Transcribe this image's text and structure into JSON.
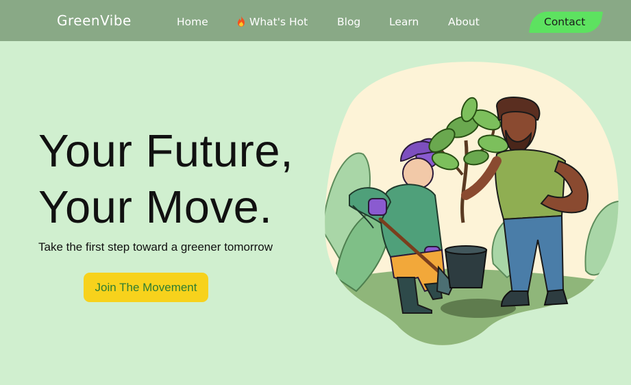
{
  "brand": {
    "name": "GreenVibe"
  },
  "nav": {
    "items": [
      {
        "label": "Home"
      },
      {
        "label": "What's Hot",
        "icon": "fire-icon"
      },
      {
        "label": "Blog"
      },
      {
        "label": "Learn"
      },
      {
        "label": "About"
      }
    ],
    "contact_label": "Contact"
  },
  "hero": {
    "title_line1": "Your Future,",
    "title_line2": "Your Move.",
    "subtitle": "Take the first step toward a greener tomorrow",
    "cta_label": "Join The Movement"
  },
  "colors": {
    "page_bg": "#d0efcf",
    "nav_bg": "#89a986",
    "contact_bg": "#5de260",
    "cta_bg": "#f7d21c",
    "cta_text": "#2e7d32"
  }
}
